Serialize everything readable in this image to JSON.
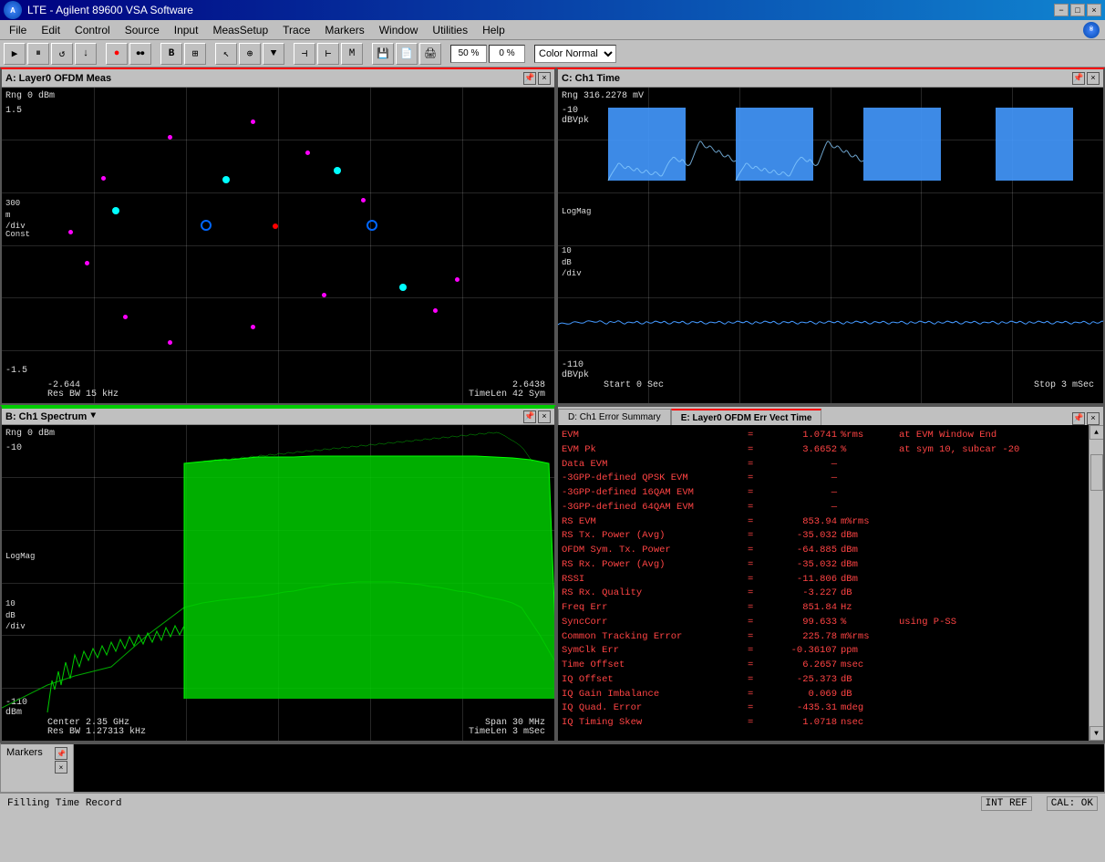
{
  "title_bar": {
    "title": "LTE - Agilent 89600 VSA Software",
    "minimize": "−",
    "maximize": "□",
    "close": "×"
  },
  "menu": {
    "items": [
      "File",
      "Edit",
      "Control",
      "Source",
      "Input",
      "MeasSetup",
      "Trace",
      "Markers",
      "Window",
      "Utilities",
      "Help"
    ]
  },
  "toolbar": {
    "zoom_input": "50 %",
    "zoom_input2": "0 %",
    "color_mode": "Color Normal"
  },
  "panel_a": {
    "title": "A: Layer0 OFDM Meas",
    "y_top": "1.5",
    "y_bottom": "-1.5",
    "y_label": "Const",
    "y_div": "300\nm\n/div",
    "x_left": "-2.644",
    "x_right": "2.6438",
    "res_bw": "Res BW 15 kHz",
    "time_len": "TimeLen 42  Sym",
    "range": "Rng 0 dBm"
  },
  "panel_b": {
    "title": "B: Ch1 Spectrum",
    "y_top": "-10",
    "y_label": "LogMag",
    "y_div": "10\ndB\n/div",
    "y_bottom": "-110\ndBm",
    "x_center": "Center 2.35 GHz",
    "x_span": "Span 30 MHz",
    "res_bw": "Res BW 1.27313 kHz",
    "time_len": "TimeLen 3 mSec",
    "range": "Rng 0 dBm"
  },
  "panel_c": {
    "title": "C: Ch1 Time",
    "y_top": "-10",
    "y_label1": "dBVpk",
    "y_label2": "LogMag",
    "y_div": "10\ndB\n/div",
    "y_bottom": "-110\ndBVpk",
    "x_start": "Start 0  Sec",
    "x_stop": "Stop 3 mSec",
    "range": "Rng 316.2278 mV"
  },
  "panel_de": {
    "tab_d": "D: Ch1 Error Summary",
    "tab_e": "E: Layer0 OFDM Err Vect Time",
    "active_tab": "E",
    "error_data": [
      {
        "label": "EVM",
        "equals": "=",
        "value": "1.0741",
        "unit": "%rms",
        "extra": "at  EVM Window End"
      },
      {
        "label": "EVM Pk",
        "equals": "=",
        "value": "3.6652",
        "unit": "%",
        "extra": "at  sym 10,  subcar -20"
      },
      {
        "label": "Data EVM",
        "equals": "=",
        "value": "—"
      },
      {
        "label": "-3GPP-defined QPSK EVM",
        "equals": "=",
        "value": "—"
      },
      {
        "label": "-3GPP-defined 16QAM EVM",
        "equals": "=",
        "value": "—"
      },
      {
        "label": "-3GPP-defined 64QAM EVM",
        "equals": "=",
        "value": "—"
      },
      {
        "label": "RS EVM",
        "equals": "=",
        "value": "853.94",
        "unit": "m%rms"
      },
      {
        "label": "RS Tx. Power (Avg)",
        "equals": "=",
        "value": "-35.032",
        "unit": "dBm"
      },
      {
        "label": "OFDM Sym. Tx. Power",
        "equals": "=",
        "value": "-64.885",
        "unit": "dBm"
      },
      {
        "label": "RS Rx. Power (Avg)",
        "equals": "=",
        "value": "-35.032",
        "unit": "dBm"
      },
      {
        "label": "RSSI",
        "equals": "=",
        "value": "-11.806",
        "unit": "dBm"
      },
      {
        "label": "RS Rx. Quality",
        "equals": "=",
        "value": "-3.227",
        "unit": "dB"
      },
      {
        "label": "Freq Err",
        "equals": "=",
        "value": "851.84",
        "unit": "Hz"
      },
      {
        "label": "SyncCorr",
        "equals": "=",
        "value": "99.633",
        "unit": "%",
        "extra": "using  P-SS"
      },
      {
        "label": "Common Tracking Error",
        "equals": "=",
        "value": "225.78",
        "unit": "m%rms"
      },
      {
        "label": "SymClk Err",
        "equals": "=",
        "value": "-0.36107",
        "unit": "ppm"
      },
      {
        "label": "Time Offset",
        "equals": "=",
        "value": "6.2657",
        "unit": "msec"
      },
      {
        "label": "IQ Offset",
        "equals": "=",
        "value": "-25.373",
        "unit": "dB"
      },
      {
        "label": "IQ Gain Imbalance",
        "equals": "=",
        "value": "0.069",
        "unit": "dB"
      },
      {
        "label": "IQ Quad. Error",
        "equals": "=",
        "value": "-435.31",
        "unit": "mdeg"
      },
      {
        "label": "IQ Timing Skew",
        "equals": "=",
        "value": "1.0718",
        "unit": "nsec"
      }
    ]
  },
  "markers": {
    "title": "Markers"
  },
  "status_bar": {
    "left": "Filling Time Record",
    "right_items": [
      "INT REF",
      "CAL: OK"
    ]
  },
  "colors": {
    "accent_red": "#ff0000",
    "bg_dark": "#000000",
    "bg_panel": "#c0c0c0",
    "signal_blue": "#4499ff",
    "signal_green": "#00ff00",
    "text_red": "#ff4444",
    "dot_cyan": "#00ffff",
    "dot_magenta": "#ff00ff",
    "dot_red": "#ff0000",
    "dot_blue": "#0066ff"
  }
}
